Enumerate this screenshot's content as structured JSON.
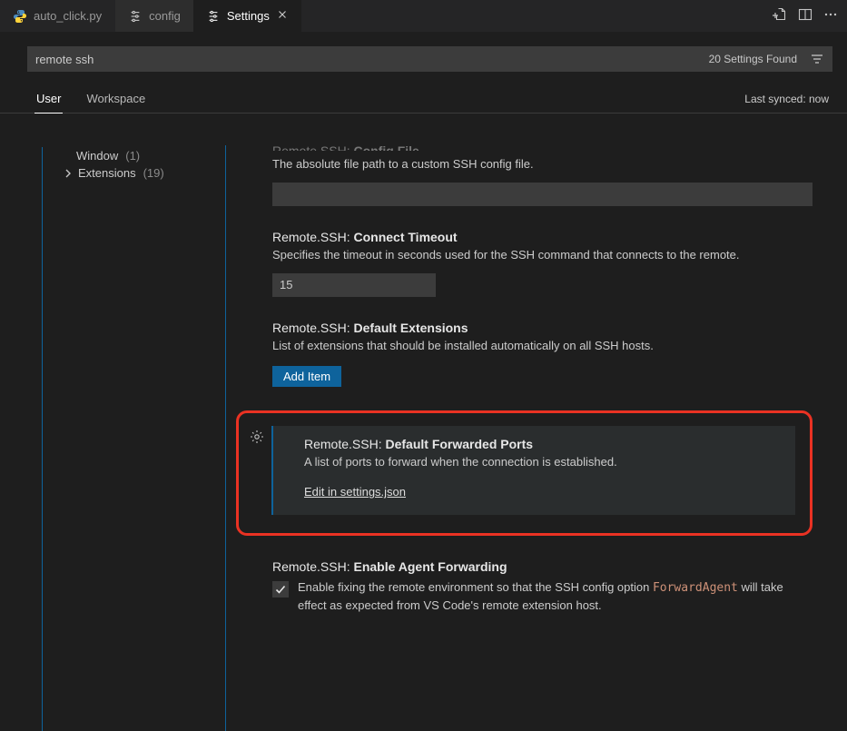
{
  "tabs": [
    {
      "label": "auto_click.py",
      "icon": "python-icon"
    },
    {
      "label": "config",
      "icon": "settings-icon"
    },
    {
      "label": "Settings",
      "icon": "settings-icon",
      "active": true
    }
  ],
  "search": {
    "value": "remote ssh",
    "found_label": "20 Settings Found"
  },
  "scopes": {
    "user": "User",
    "workspace": "Workspace",
    "sync": "Last synced: now"
  },
  "sidebar": {
    "window": {
      "label": "Window",
      "count": "(1)"
    },
    "extensions": {
      "label": "Extensions",
      "count": "(19)"
    }
  },
  "settings": {
    "configFile": {
      "title_cat": "Remote.SSH:",
      "title_name": "Config File",
      "desc": "The absolute file path to a custom SSH config file.",
      "value": ""
    },
    "connectTimeout": {
      "title_cat": "Remote.SSH:",
      "title_name": "Connect Timeout",
      "desc": "Specifies the timeout in seconds used for the SSH command that connects to the remote.",
      "value": "15"
    },
    "defaultExtensions": {
      "title_cat": "Remote.SSH:",
      "title_name": "Default Extensions",
      "desc": "List of extensions that should be installed automatically on all SSH hosts.",
      "add_item": "Add Item"
    },
    "defaultForwardedPorts": {
      "title_cat": "Remote.SSH:",
      "title_name": "Default Forwarded Ports",
      "desc": "A list of ports to forward when the connection is established.",
      "edit_link": "Edit in settings.json"
    },
    "enableAgentForwarding": {
      "title_cat": "Remote.SSH:",
      "title_name": "Enable Agent Forwarding",
      "desc_pre": "Enable fixing the remote environment so that the SSH config option ",
      "code": "ForwardAgent",
      "desc_post": " will take effect as expected from VS Code's remote extension host.",
      "checked": true
    }
  }
}
